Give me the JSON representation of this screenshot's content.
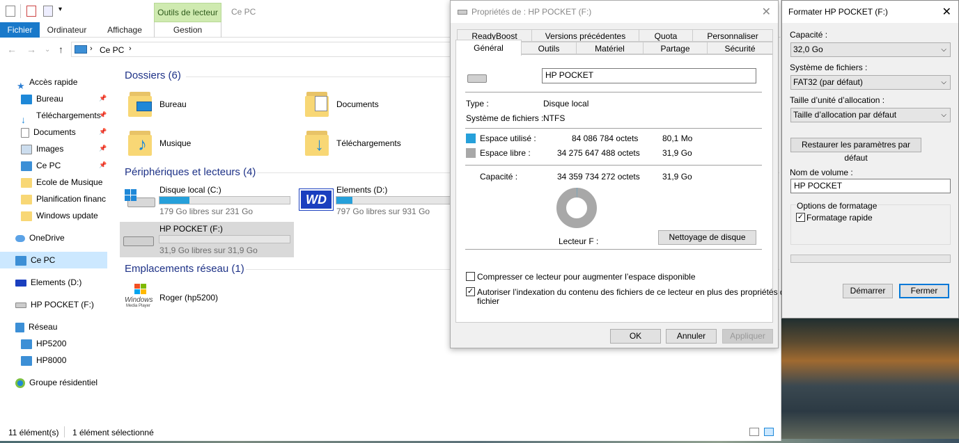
{
  "explorer": {
    "tabs": {
      "fichier": "Fichier",
      "ordinateur": "Ordinateur",
      "affichage": "Affichage",
      "gestion": "Gestion"
    },
    "context_tab": "Outils de lecteur",
    "window_title": "Ce PC",
    "address": "Ce PC",
    "nav": {
      "quick_access": "Accès rapide",
      "items": [
        "Bureau",
        "Téléchargements",
        "Documents",
        "Images",
        "Ce PC",
        "Ecole de Musique",
        "Planification financ",
        "Windows update"
      ],
      "onedrive": "OneDrive",
      "thispc": "Ce PC",
      "elements": "Elements (D:)",
      "hppocket": "HP POCKET (F:)",
      "network": "Réseau",
      "hp5200": "HP5200",
      "hp8000": "HP8000",
      "homegroup": "Groupe résidentiel"
    },
    "groups": {
      "folders": "Dossiers (6)",
      "devices": "Périphériques et lecteurs (4)",
      "network": "Emplacements réseau (1)"
    },
    "folders": [
      "Bureau",
      "Documents",
      "Musique",
      "Téléchargements"
    ],
    "drives": [
      {
        "name": "Disque local (C:)",
        "free": "179 Go libres sur 231 Go",
        "used_frac": 0.23
      },
      {
        "name": "Elements (D:)",
        "free": "797 Go libres sur 931 Go",
        "used_frac": 0.14
      },
      {
        "name": "HP POCKET (F:)",
        "free": "31,9 Go libres sur 31,9 Go",
        "used_frac": 0.0
      }
    ],
    "netloc": "Roger (hp5200)",
    "wmp_line1": "Windows",
    "wmp_line2": "Media Player",
    "status": {
      "count": "11 élément(s)",
      "selected": "1 élément sélectionné"
    }
  },
  "props": {
    "title": "Propriétés de : HP POCKET (F:)",
    "tabs_top": [
      "ReadyBoost",
      "Versions précédentes",
      "Quota",
      "Personnaliser"
    ],
    "tabs_bottom": [
      "Général",
      "Outils",
      "Matériel",
      "Partage",
      "Sécurité"
    ],
    "label": "HP POCKET",
    "type_label": "Type :",
    "type_val": "Disque local",
    "fs_label": "Système de fichiers :",
    "fs_val": "NTFS",
    "used_label": "Espace utilisé :",
    "used_bytes": "84 086 784 octets",
    "used_size": "80,1 Mo",
    "free_label": "Espace libre :",
    "free_bytes": "34 275 647 488 octets",
    "free_size": "31,9 Go",
    "cap_label": "Capacité :",
    "cap_bytes": "34 359 734 272 octets",
    "cap_size": "31,9 Go",
    "drive_label": "Lecteur F :",
    "cleanup": "Nettoyage de disque",
    "compress": "Compresser ce lecteur pour augmenter l’espace disponible",
    "index1": "Autoriser l’indexation du contenu des fichiers de ce lecteur en plus des propriétés de",
    "index2": "fichier",
    "ok": "OK",
    "cancel": "Annuler",
    "apply": "Appliquer",
    "colors": {
      "used": "#26a0da",
      "free": "#a8a8a8"
    }
  },
  "fmt": {
    "title": "Formater HP POCKET (F:)",
    "cap_label": "Capacité :",
    "cap_val": "32,0 Go",
    "fs_label": "Système de fichiers :",
    "fs_val": "FAT32 (par défaut)",
    "alloc_label": "Taille d’unité d’allocation :",
    "alloc_val": "Taille d’allocation par défaut",
    "restore": "Restaurer les paramètres par défaut",
    "vol_label": "Nom de volume :",
    "vol_val": "HP POCKET",
    "options": "Options de formatage",
    "quick": "Formatage rapide",
    "start": "Démarrer",
    "close": "Fermer"
  }
}
